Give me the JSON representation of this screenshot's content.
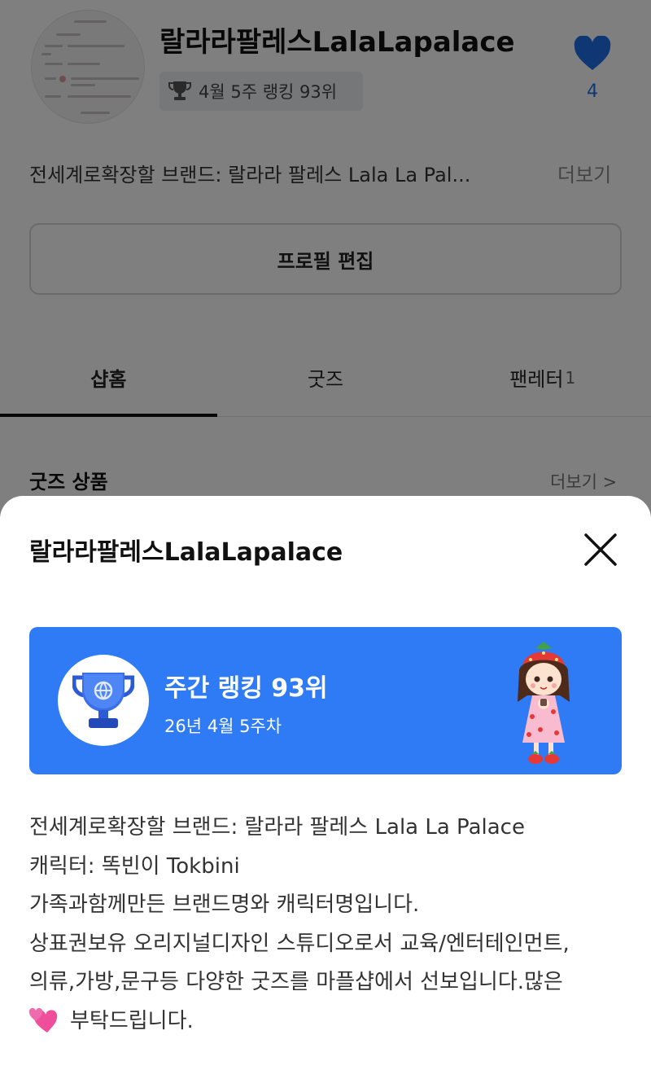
{
  "profile": {
    "shop_name": "랄라라팔레스LalaLapalace",
    "rank_badge": "4월 5주 랭킹 93위",
    "like_count": "4",
    "bio_preview": "전세계로확장할 브랜드: 랄라라 팔레스 Lala La Pal...",
    "more_label": "더보기",
    "edit_button": "프로필 편집",
    "tabs": [
      {
        "label": "샵홈",
        "count": ""
      },
      {
        "label": "굿즈",
        "count": ""
      },
      {
        "label": "팬레터",
        "count": "1"
      }
    ],
    "section_title": "굿즈 상품",
    "section_more": "더보기 >"
  },
  "sheet": {
    "title": "랄라라팔레스LalaLapalace",
    "rank_card": {
      "title": "주간 랭킹 93위",
      "week": "26년 4월 5주차"
    },
    "bio_lines": [
      "전세계로확장할 브랜드: 랄라라 팔레스 Lala La Palace",
      "캐릭터: 똑빈이 Tokbini",
      "가족과함께만든 브랜드명와 캐릭터명입니다.",
      "상표권보유 오리지널디자인 스튜디오로서 교육/엔터테인먼트,",
      "의류,가방,문구등 다양한 굿즈를 마플샵에서 선보입니다.많은",
      "부탁드립니다."
    ]
  },
  "icons": {
    "trophy": "trophy-icon",
    "heart": "heart-icon",
    "close": "close-icon",
    "emoji": "two-hearts-emoji"
  },
  "colors": {
    "accent_blue": "#2f7bf5",
    "like_blue": "#1f6fe8",
    "emoji_pink": "#ef4f9a"
  }
}
